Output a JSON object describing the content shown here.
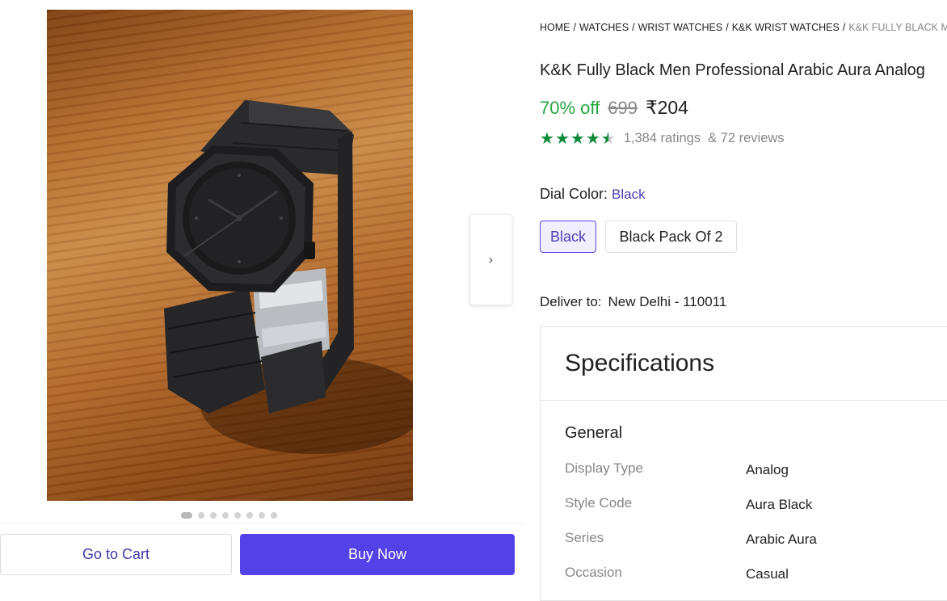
{
  "gallery": {
    "next_icon": "chevron-right-icon",
    "next_glyph": "›",
    "dot_count": 8,
    "active_dot": 0
  },
  "actions": {
    "go_to_cart": "Go to Cart",
    "buy_now": "Buy Now"
  },
  "breadcrumb": [
    "HOME",
    "WATCHES",
    "WRIST WATCHES",
    "K&K WRIST WATCHES",
    "K&K FULLY BLACK M"
  ],
  "product": {
    "title": "K&K Fully Black Men Professional Arabic Aura Analog",
    "discount": "70% off",
    "mrp": "699",
    "price": "₹204",
    "rating_value": 4.5,
    "ratings": "1,384 ratings",
    "reviews": "& 72 reviews"
  },
  "dial_color": {
    "label": "Dial Color:",
    "value": "Black",
    "options": [
      "Black",
      "Black Pack Of 2"
    ]
  },
  "delivery": {
    "label": "Deliver to:",
    "location": "New Delhi - 110011"
  },
  "specifications": {
    "title": "Specifications",
    "group": "General",
    "rows": [
      {
        "key": "Display Type",
        "value": "Analog"
      },
      {
        "key": "Style Code",
        "value": "Aura Black"
      },
      {
        "key": "Series",
        "value": "Arabic Aura"
      },
      {
        "key": "Occasion",
        "value": "Casual"
      }
    ]
  },
  "colors": {
    "accent": "#5442e9",
    "discount_green": "#26a541",
    "star_green": "#0e8a3a",
    "muted_text": "#878787"
  }
}
